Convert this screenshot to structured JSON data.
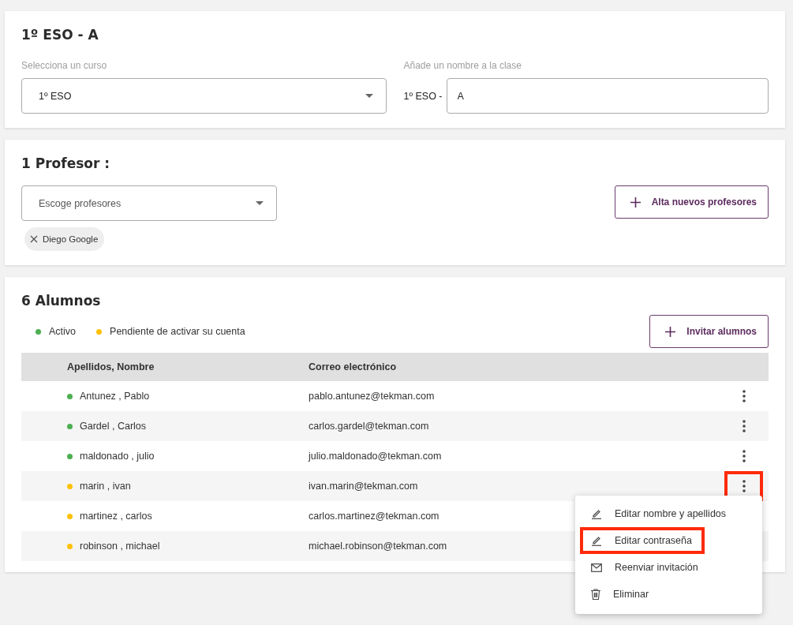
{
  "class_card": {
    "title": "1º ESO - A",
    "course_label": "Selecciona un curso",
    "course_value": "1º ESO",
    "name_label": "Añade un nombre a la clase",
    "name_prefix": "1º ESO -",
    "name_value": "A"
  },
  "teachers_card": {
    "title": "1 Profesor :",
    "select_placeholder": "Escoge profesores",
    "add_button": "Alta nuevos profesores",
    "chips": [
      {
        "label": "Diego Google"
      }
    ]
  },
  "students_card": {
    "title": "6 Alumnos",
    "legend": [
      {
        "label": "Activo",
        "color": "#4caf50"
      },
      {
        "label": "Pendiente de activar su cuenta",
        "color": "#ffc107"
      }
    ],
    "invite_button": "Invitar alumnos",
    "columns": [
      "Apellidos, Nombre",
      "Correo electrónico"
    ],
    "rows": [
      {
        "name": "Antunez , Pablo",
        "email": "pablo.antunez@tekman.com",
        "color": "#4caf50",
        "highlighted": false
      },
      {
        "name": "Gardel , Carlos",
        "email": "carlos.gardel@tekman.com",
        "color": "#4caf50",
        "highlighted": false
      },
      {
        "name": "maldonado , julio",
        "email": "julio.maldonado@tekman.com",
        "color": "#4caf50",
        "highlighted": false
      },
      {
        "name": "marin , ivan",
        "email": "ivan.marin@tekman.com",
        "color": "#ffc107",
        "highlighted": true
      },
      {
        "name": "martinez , carlos",
        "email": "carlos.martinez@tekman.com",
        "color": "#ffc107",
        "highlighted": false
      },
      {
        "name": "robinson , michael",
        "email": "michael.robinson@tekman.com",
        "color": "#ffc107",
        "highlighted": false
      }
    ],
    "menu": [
      {
        "kind": "edit",
        "label": "Editar nombre y apellidos",
        "highlighted": false
      },
      {
        "kind": "edit",
        "label": "Editar contraseña",
        "highlighted": true
      },
      {
        "kind": "mail",
        "label": "Reenviar invitación",
        "highlighted": false
      },
      {
        "kind": "delete",
        "label": "Eliminar",
        "highlighted": false
      }
    ]
  }
}
